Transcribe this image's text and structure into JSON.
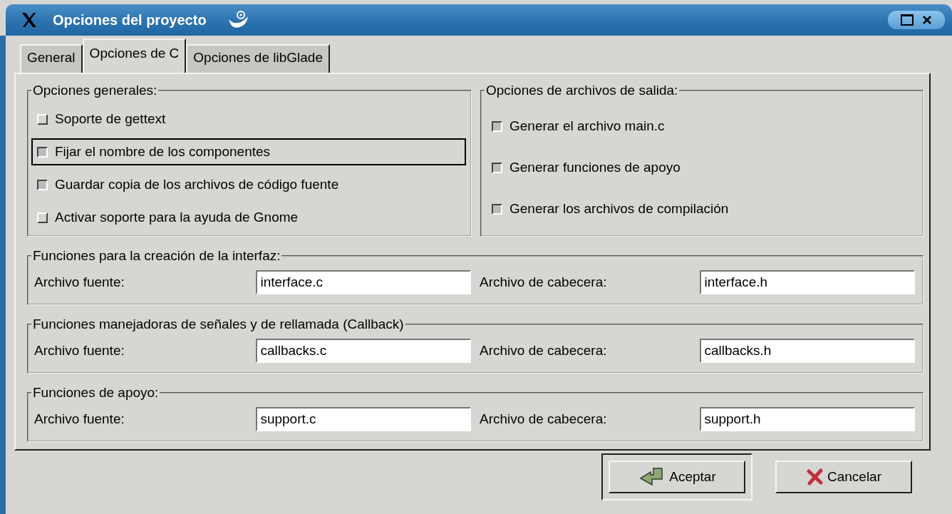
{
  "window": {
    "title": "Opciones del proyecto"
  },
  "tabs": [
    {
      "label": "General",
      "selected": false
    },
    {
      "label": "Opciones de C",
      "selected": true
    },
    {
      "label": "Opciones de libGlade",
      "selected": false
    }
  ],
  "general_options": {
    "title": "Opciones generales:",
    "items": [
      {
        "label": "Soporte de gettext",
        "checked": false,
        "focused": false
      },
      {
        "label": "Fijar el nombre de los componentes",
        "checked": true,
        "focused": true
      },
      {
        "label": "Guardar copia de los archivos de código fuente",
        "checked": true,
        "focused": false
      },
      {
        "label": "Activar soporte para la ayuda de Gnome",
        "checked": false,
        "focused": false
      }
    ]
  },
  "output_options": {
    "title": "Opciones de archivos de salida:",
    "items": [
      {
        "label": "Generar el archivo main.c",
        "checked": true
      },
      {
        "label": "Generar funciones de apoyo",
        "checked": true
      },
      {
        "label": "Generar los archivos de compilación",
        "checked": true
      }
    ]
  },
  "file_groups": [
    {
      "title": "Funciones para la creación de la interfaz:",
      "source_label": "Archivo fuente:",
      "source": "interface.c",
      "header_label": "Archivo de cabecera:",
      "header": "interface.h"
    },
    {
      "title": "Funciones manejadoras de señales y de rellamada (Callback)",
      "source_label": "Archivo fuente:",
      "source": "callbacks.c",
      "header_label": "Archivo de cabecera:",
      "header": "callbacks.h"
    },
    {
      "title": "Funciones de apoyo:",
      "source_label": "Archivo fuente:",
      "source": "support.c",
      "header_label": "Archivo de cabecera:",
      "header": "support.h"
    }
  ],
  "buttons": [
    {
      "label": "Aceptar",
      "kind": "accept",
      "default": true
    },
    {
      "label": "Cancelar",
      "kind": "cancel",
      "default": false
    }
  ]
}
